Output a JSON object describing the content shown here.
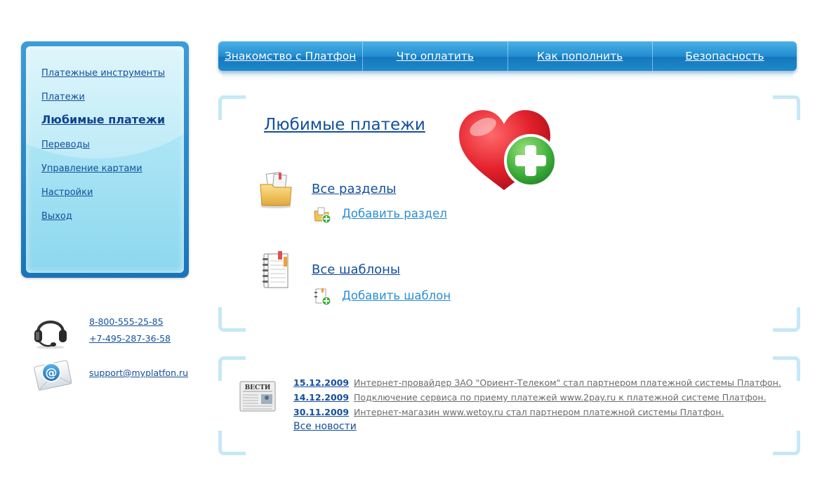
{
  "sidebar": {
    "items": [
      {
        "label": "Платежные инструменты",
        "active": false
      },
      {
        "label": "Платежи",
        "active": false
      },
      {
        "label": "Любимые платежи",
        "active": true
      },
      {
        "label": "Переводы",
        "active": false
      },
      {
        "label": "Управление картами",
        "active": false
      },
      {
        "label": "Настройки",
        "active": false
      },
      {
        "label": "Выход",
        "active": false
      }
    ]
  },
  "contacts": {
    "phone1": "8-800-555-25-85",
    "phone2": "+7-495-287-36-58",
    "email": "support@myplatfon.ru",
    "icons": [
      "headset-icon",
      "mail-icon"
    ]
  },
  "nav": {
    "tabs": [
      {
        "label": "Знакомство с Платфон"
      },
      {
        "label": "Что оплатить"
      },
      {
        "label": "Как пополнить"
      },
      {
        "label": "Безопасность"
      }
    ]
  },
  "main": {
    "title": "Любимые платежи",
    "sections_label": "Все разделы",
    "add_section_label": "Добавить раздел",
    "templates_label": "Все шаблоны",
    "add_template_label": "Добавить шаблон",
    "icons": [
      "heart-plus-icon",
      "folder-icon",
      "notebook-icon"
    ]
  },
  "news": {
    "icon_label": "ВЕСТИ",
    "items": [
      {
        "date": "15.12.2009",
        "text": "Интернет-провайдер ЗАО \"Ориент-Телеком\" стал партнером платежной системы Платфон."
      },
      {
        "date": "14.12.2009",
        "text": "Подключение сервиса по приему платежей www.2pay.ru к платежной системе Платфон."
      },
      {
        "date": "30.11.2009",
        "text": "Интернет-магазин www.wetoy.ru стал партнером платежной системы Платфон."
      }
    ],
    "all_news_label": "Все новости"
  },
  "colors": {
    "link": "#134f9c",
    "nav_blue": "#1f8bcf",
    "add_link": "#2a8ed3",
    "heart_red": "#e3212c",
    "plus_green": "#3cae3a",
    "news_text": "#6b6b6b"
  }
}
